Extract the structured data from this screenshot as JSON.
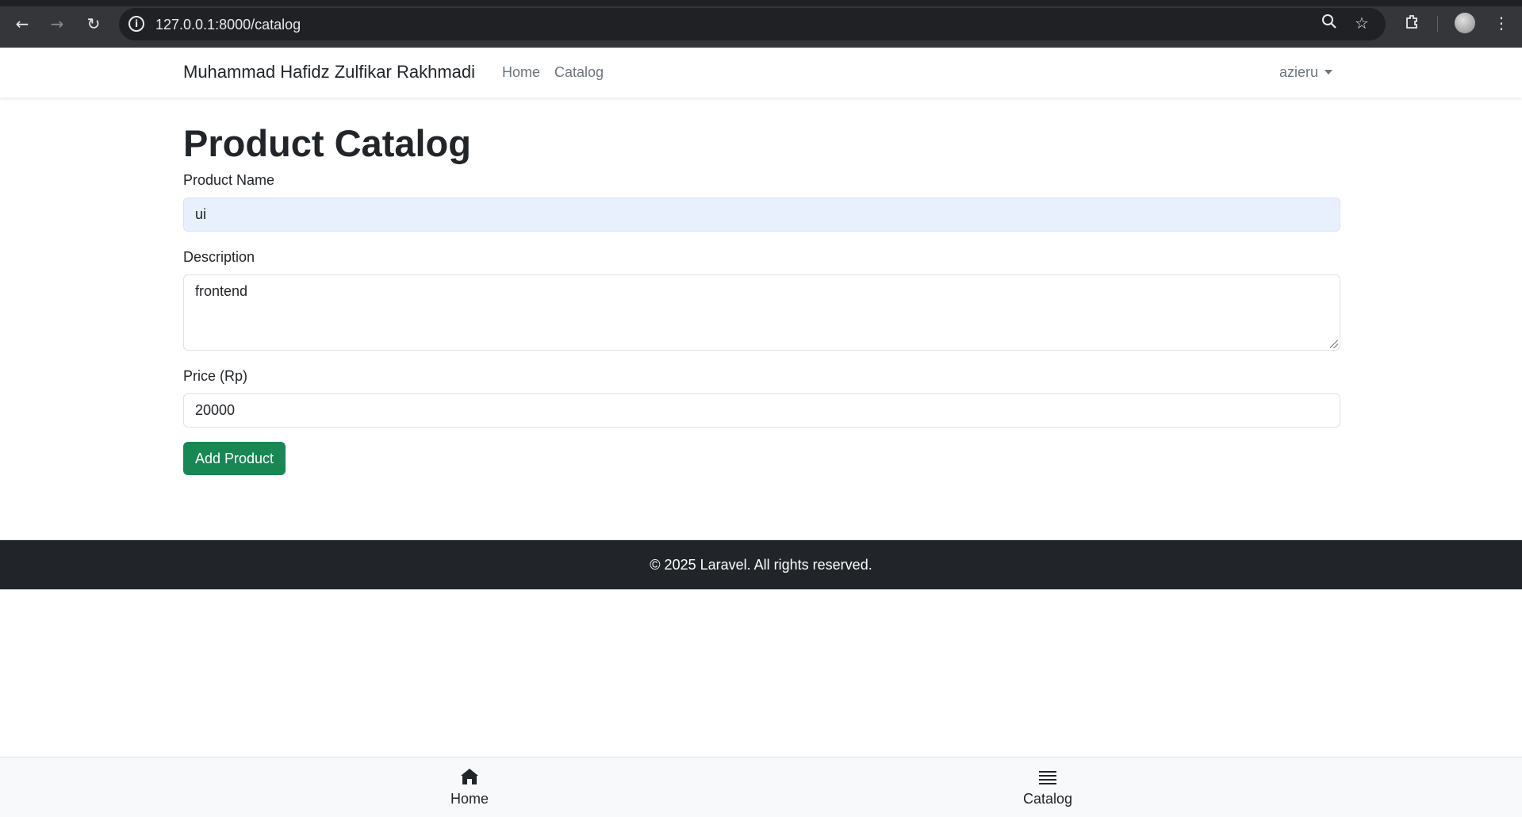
{
  "browser": {
    "url": "127.0.0.1:8000/catalog",
    "back_icon": "back-arrow-icon",
    "forward_icon": "forward-arrow-icon",
    "reload_icon": "reload-icon"
  },
  "navbar": {
    "brand": "Muhammad Hafidz Zulfikar Rakhmadi",
    "links": [
      "Home",
      "Catalog"
    ],
    "user": "azieru"
  },
  "main": {
    "title": "Product Catalog",
    "form": {
      "name_label": "Product Name",
      "name_value": "ui",
      "description_label": "Description",
      "description_value": "frontend",
      "price_label": "Price (Rp)",
      "price_value": "20000",
      "submit_label": "Add Product"
    }
  },
  "footer": {
    "text": "© 2025 Laravel. All rights reserved."
  },
  "tabbar": {
    "items": [
      {
        "label": "Home",
        "icon": "home-icon"
      },
      {
        "label": "Catalog",
        "icon": "list-icon"
      }
    ]
  },
  "colors": {
    "primary_button": "#198754",
    "footer_bg": "#212529",
    "autofill_bg": "#e8f0fe"
  }
}
